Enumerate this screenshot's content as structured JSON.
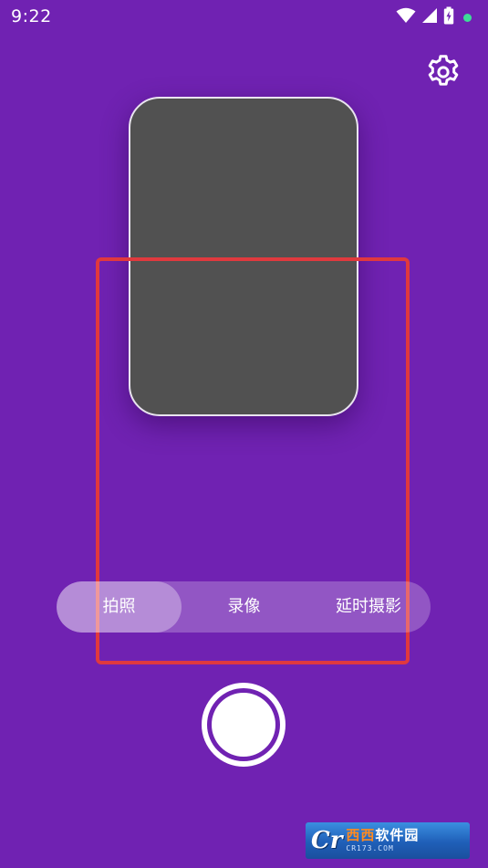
{
  "status_bar": {
    "time": "9:22",
    "icons": [
      "wifi-icon",
      "signal-icon",
      "battery-charging-icon",
      "notification-dot-icon"
    ],
    "dot_color": "#3ddc97"
  },
  "colors": {
    "background": "#7022b2",
    "preview": "#515151",
    "highlight": "#e0393e"
  },
  "settings": {
    "icon": "gear-icon"
  },
  "modes": {
    "selected": "拍照",
    "items": [
      {
        "label": "拍照"
      },
      {
        "label": "录像"
      },
      {
        "label": "延时摄影"
      }
    ]
  },
  "shutter": {
    "icon": "shutter-button"
  },
  "watermark": {
    "mark": "Cr",
    "cn_accent": "西西",
    "cn_rest": "软件园",
    "en": "CR173.COM"
  }
}
